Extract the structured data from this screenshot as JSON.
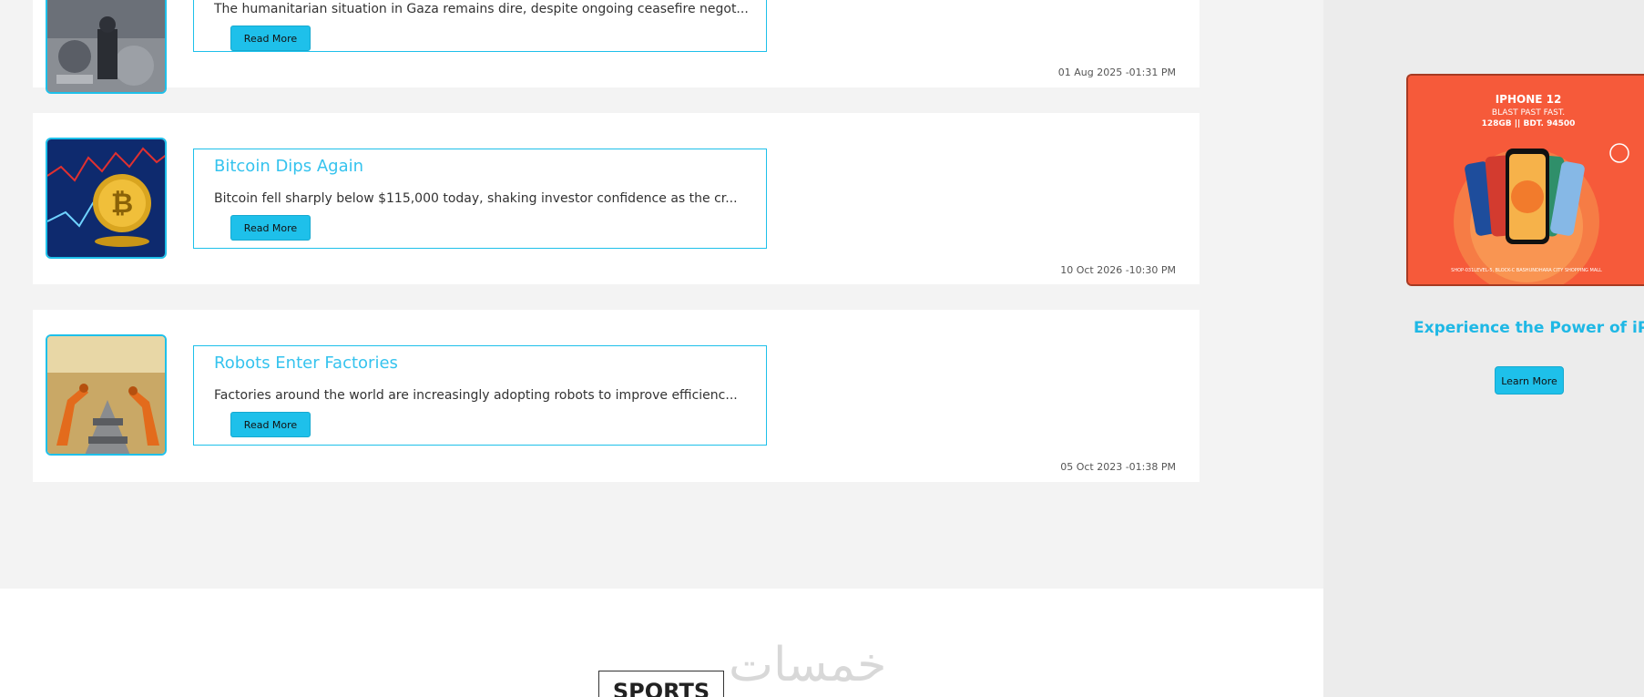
{
  "news_list": [
    {
      "title": "",
      "summary": "The humanitarian situation in Gaza remains dire, despite ongoing ceasefire negot...",
      "button_label": "Read More",
      "date": "01 Aug 2025 -01:31 PM",
      "image_icon": "rubble-photo"
    },
    {
      "title": "Bitcoin Dips Again",
      "summary": "Bitcoin fell sharply below $115,000 today, shaking investor confidence as the cr...",
      "button_label": "Read More",
      "date": "10 Oct 2026 -10:30 PM",
      "image_icon": "bitcoin-photo"
    },
    {
      "title": "Robots Enter Factories",
      "summary": "Factories around the world are increasingly adopting robots to improve efficienc...",
      "button_label": "Read More",
      "date": "05 Oct 2023 -01:38 PM",
      "image_icon": "factory-robots-photo"
    }
  ],
  "ad": {
    "image_title": "IPHONE 12",
    "image_tagline": "BLAST PAST FAST.",
    "image_specs": "128GB || BDT. 94500",
    "image_address": "SHOP-031LEVEL-5, BLOCK-C BASHUNDHARA CITY SHOPPING MALL",
    "title": "Experience the Power of iPhone",
    "button_label": "Learn More"
  },
  "sports": {
    "heading": "SPORTS"
  },
  "watermark": "خمسات",
  "colors": {
    "accent": "#1ec0ea",
    "headline": "#35c3ee",
    "ad_background": "#f65a3a"
  }
}
